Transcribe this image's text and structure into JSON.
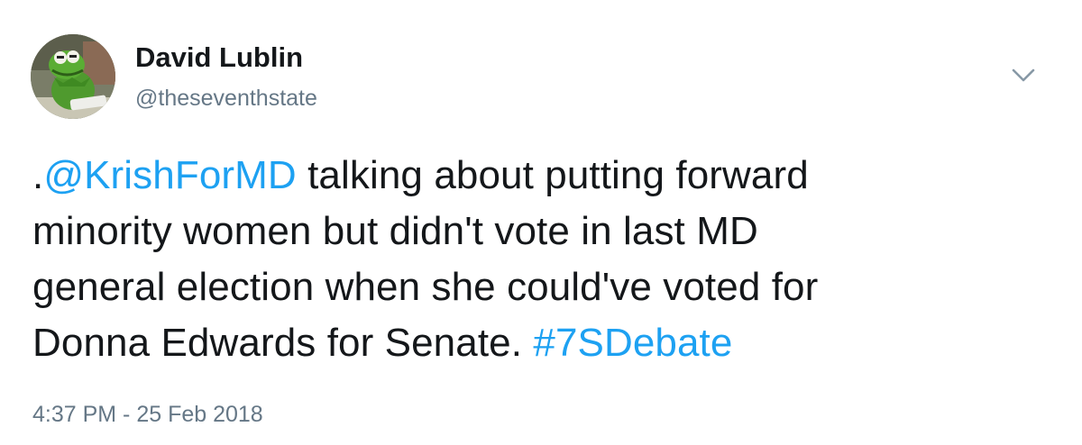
{
  "author": {
    "name": "David Lublin",
    "handle": "@theseventhstate",
    "avatar_icon": "kermit-frog-avatar"
  },
  "menu": {
    "icon": "chevron-down-icon"
  },
  "tweet": {
    "prefix": ".",
    "mention": "@KrishForMD",
    "line1_rest": " talking about putting forward",
    "line2": "minority women but didn't vote in last MD",
    "line3": "general election when she could've voted for",
    "line4": "Donna Edwards for Senate. ",
    "hashtag": "#7SDebate"
  },
  "timestamp": "4:37 PM - 25 Feb 2018",
  "colors": {
    "link": "#1da1f2",
    "text": "#14171a",
    "secondary": "#657786"
  }
}
